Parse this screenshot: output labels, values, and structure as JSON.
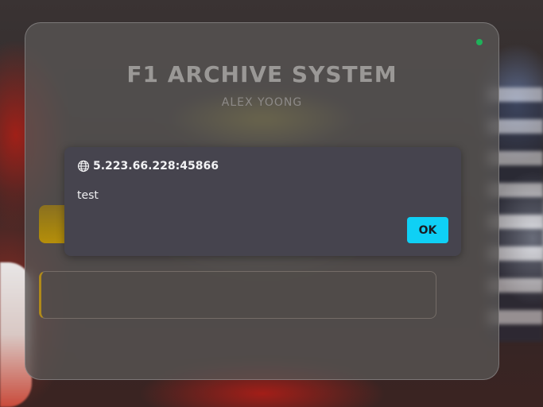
{
  "app": {
    "title": "F1 ARCHIVE SYSTEM",
    "subtitle": "ALEX YOONG",
    "status_color": "#1fb25a"
  },
  "dialog": {
    "origin": "5.223.66.228:45866",
    "origin_icon": "globe-icon",
    "message": "test",
    "ok_label": "OK",
    "ok_color": "#0fd0f5"
  },
  "options": {
    "accent_color": "#b58e0b"
  }
}
